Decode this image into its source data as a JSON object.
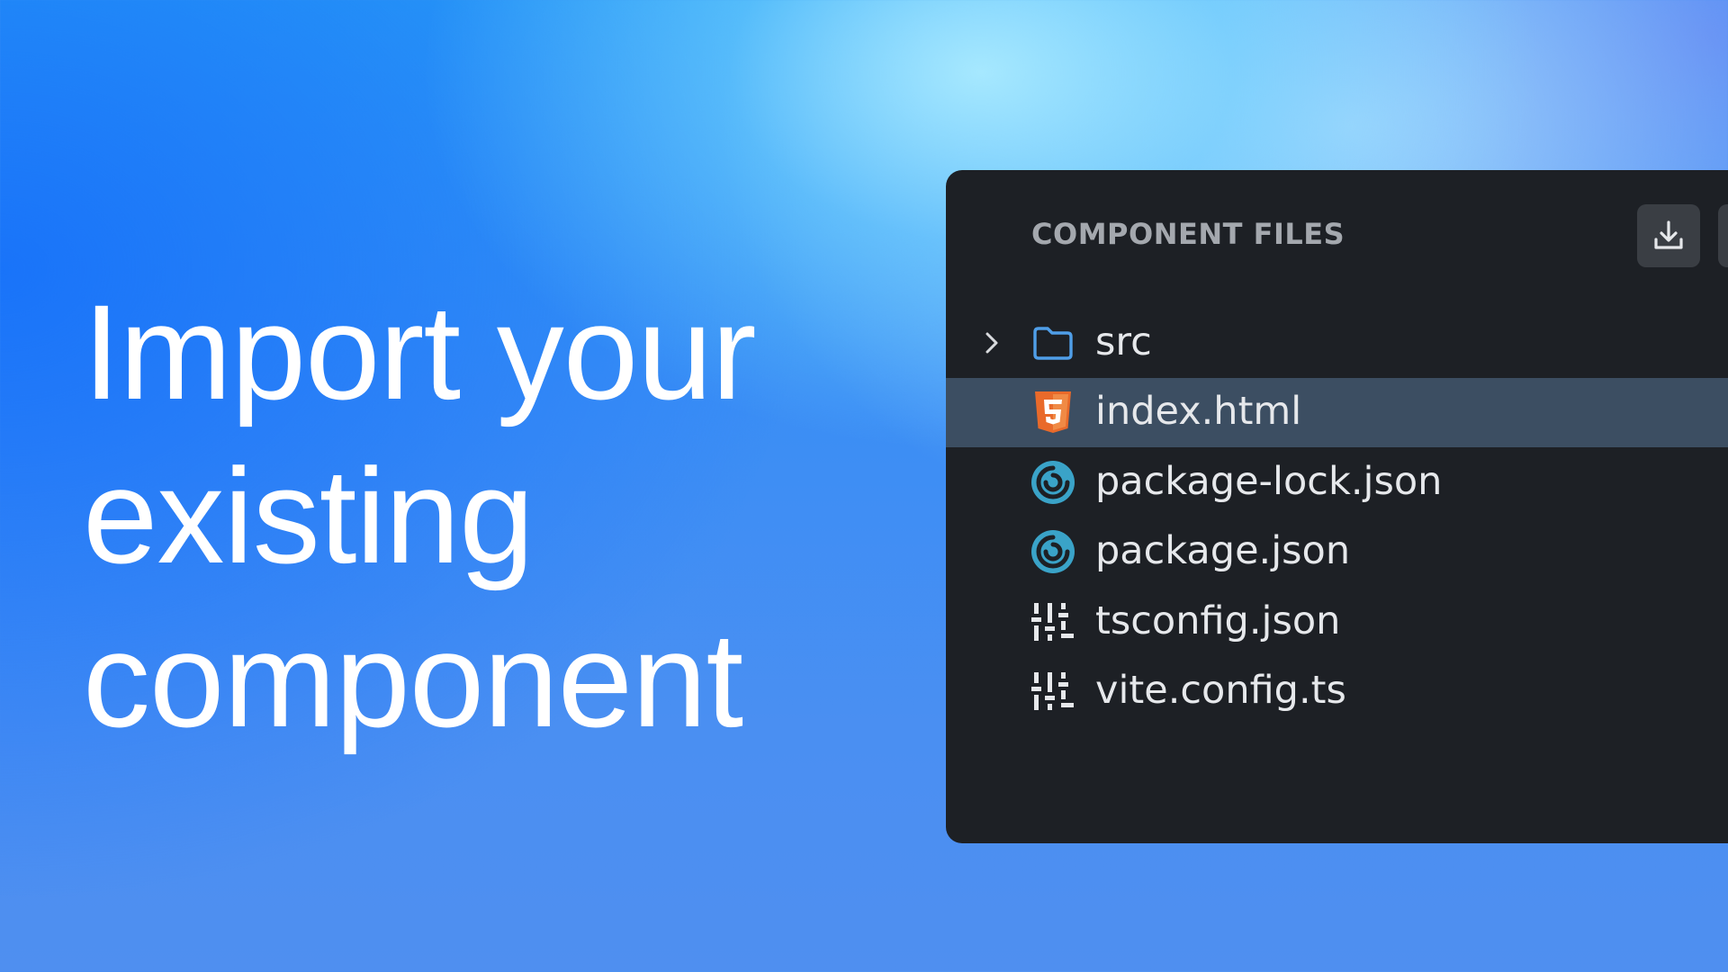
{
  "headline": {
    "line1": "Import your",
    "line2": "existing",
    "line3": "component"
  },
  "panel": {
    "title": "COMPONENT FILES",
    "download_icon": "download-icon",
    "files": [
      {
        "name": "src",
        "icon": "folder-icon",
        "expandable": true,
        "selected": false
      },
      {
        "name": "index.html",
        "icon": "html5-icon",
        "expandable": false,
        "selected": true
      },
      {
        "name": "package-lock.json",
        "icon": "json-icon",
        "expandable": false,
        "selected": false
      },
      {
        "name": "package.json",
        "icon": "json-icon",
        "expandable": false,
        "selected": false
      },
      {
        "name": "tsconfig.json",
        "icon": "config-icon",
        "expandable": false,
        "selected": false
      },
      {
        "name": "vite.config.ts",
        "icon": "config-icon",
        "expandable": false,
        "selected": false
      }
    ]
  },
  "colors": {
    "panel_background": "#1d2025",
    "selected_row": "#3c4e62",
    "folder_icon": "#4f9ee8",
    "html_icon": "#e96a2a",
    "json_icon": "#3aa3c8",
    "config_icon": "#e6e8eb"
  }
}
